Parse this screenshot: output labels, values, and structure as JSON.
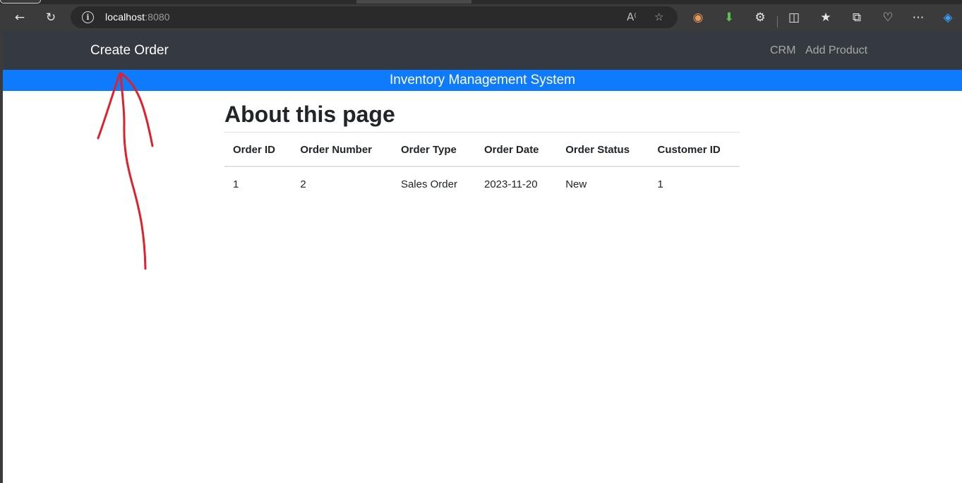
{
  "browser": {
    "url_host": "localhost",
    "url_port": ":8080"
  },
  "navbar": {
    "brand": "Create Order",
    "links": [
      "CRM",
      "Add Product"
    ]
  },
  "subbar": {
    "title": "Inventory Management System"
  },
  "page": {
    "heading": "About this page",
    "table": {
      "headers": [
        "Order ID",
        "Order Number",
        "Order Type",
        "Order Date",
        "Order Status",
        "Customer ID"
      ],
      "rows": [
        [
          "1",
          "2",
          "Sales Order",
          "2023-11-20",
          "New",
          "1"
        ]
      ]
    }
  },
  "colors": {
    "navbar_bg": "#343a40",
    "subbar_bg": "#0d7bfc",
    "annotation": "#e0202a"
  }
}
